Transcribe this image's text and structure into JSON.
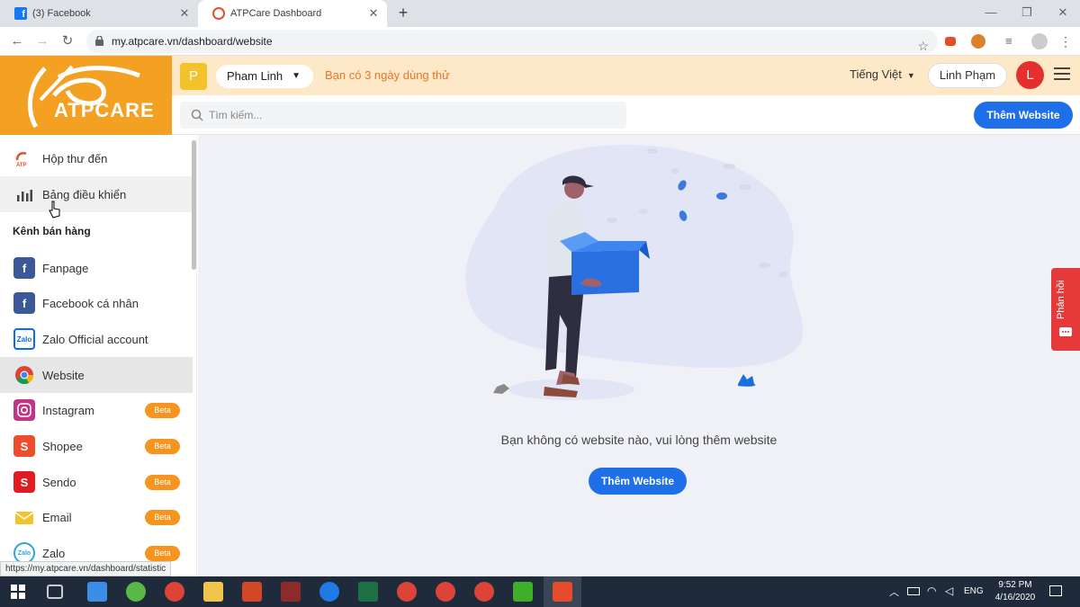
{
  "browser": {
    "tabs": [
      {
        "title": "(3) Facebook",
        "icon": "facebook-icon"
      },
      {
        "title": "ATPCare Dashboard",
        "icon": "atpcare-icon"
      }
    ],
    "url": "my.atpcare.vn/dashboard/website",
    "status_url": "https://my.atpcare.vn/dashboard/statistic"
  },
  "brand": {
    "name": "ATPCARE",
    "color": "#f4a023"
  },
  "topbar": {
    "page_initial": "P",
    "page_name": "Pham Linh",
    "trial_text": "Bạn có 3 ngày dùng thử",
    "language": "Tiếng Việt",
    "user_name": "Linh Phạm",
    "avatar_initial": "L"
  },
  "search": {
    "placeholder": "Tìm kiếm..."
  },
  "add_website_label": "Thêm Website",
  "sidebar": {
    "items_top": [
      {
        "label": "Hộp thư đến",
        "icon": "inbox-icon"
      },
      {
        "label": "Bảng điều khiển",
        "icon": "chart-icon"
      }
    ],
    "section_title": "Kênh bán hàng",
    "channels": [
      {
        "label": "Fanpage",
        "icon": "facebook-icon",
        "beta": ""
      },
      {
        "label": "Facebook cá nhân",
        "icon": "facebook-icon",
        "beta": ""
      },
      {
        "label": "Zalo Official account",
        "icon": "zalo-icon",
        "beta": ""
      },
      {
        "label": "Website",
        "icon": "chrome-icon",
        "beta": ""
      },
      {
        "label": "Instagram",
        "icon": "instagram-icon",
        "beta": "Beta"
      },
      {
        "label": "Shopee",
        "icon": "shopee-icon",
        "beta": "Beta"
      },
      {
        "label": "Sendo",
        "icon": "sendo-icon",
        "beta": "Beta"
      },
      {
        "label": "Email",
        "icon": "email-icon",
        "beta": "Beta"
      },
      {
        "label": "Zalo",
        "icon": "zalo-icon",
        "beta": "Beta"
      }
    ]
  },
  "main": {
    "empty_text": "Bạn không có website nào, vui lòng thêm website"
  },
  "feedback": {
    "label": "Phản hồi"
  },
  "taskbar": {
    "language": "ENG",
    "time": "9:52 PM",
    "date": "4/16/2020"
  }
}
